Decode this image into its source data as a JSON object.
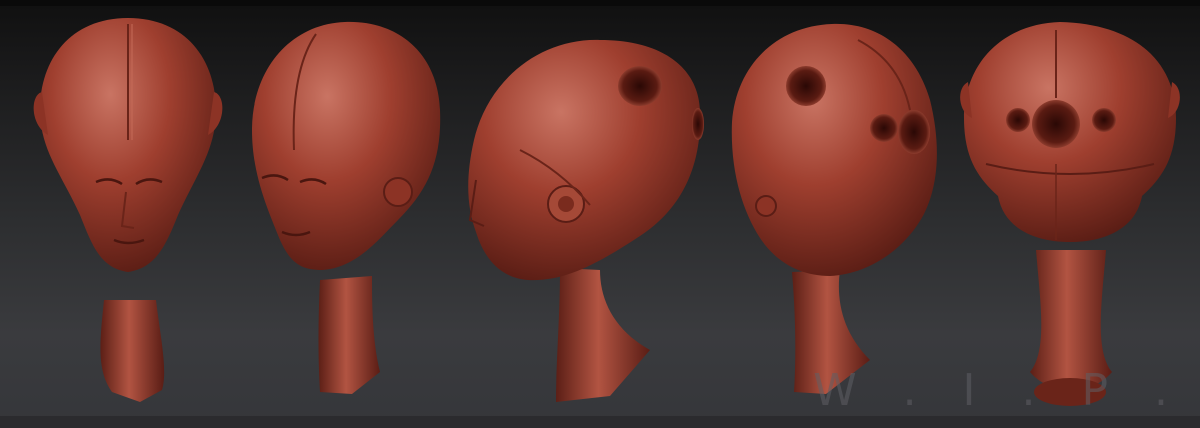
{
  "image": {
    "subject": "sculpt-turntable",
    "colors": {
      "background_top": "#101010",
      "background_bottom": "#3a3b3e",
      "clay_base": "#9a3a2a",
      "clay_light": "#c76450",
      "clay_dark": "#5c1f16"
    }
  },
  "watermark": {
    "text": "W . I . P ."
  },
  "views": [
    {
      "id": "front"
    },
    {
      "id": "three-quarter-front"
    },
    {
      "id": "profile"
    },
    {
      "id": "three-quarter-back"
    },
    {
      "id": "back"
    }
  ]
}
